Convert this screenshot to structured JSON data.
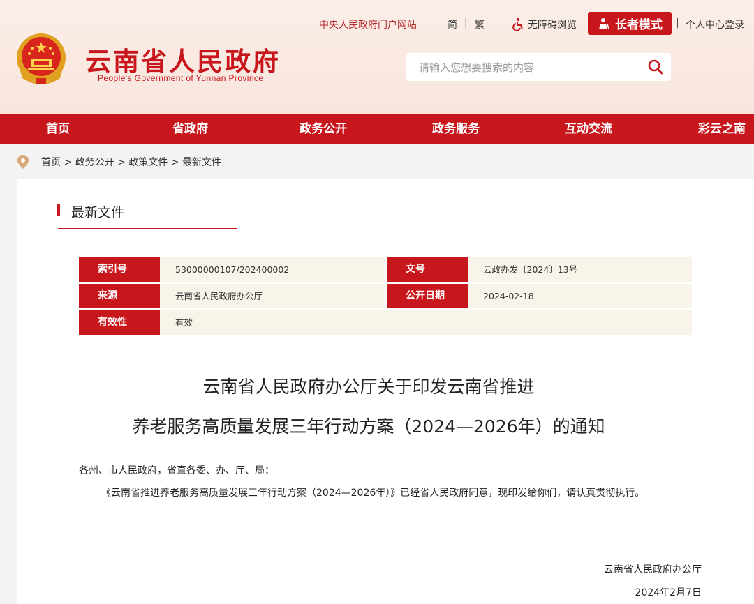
{
  "header": {
    "site_cn": "云南省人民政府",
    "site_en": "People's Government of Yunnan Province",
    "top_links": {
      "central_portal": "中央人民政府门户网站",
      "simplified": "简",
      "traditional": "繁",
      "accessibility": "无障碍浏览",
      "elder_mode": "长者模式",
      "user_center": "个人中心登录",
      "separator": "|"
    },
    "search": {
      "placeholder": "请输入您想要搜索的内容"
    }
  },
  "nav": {
    "items": [
      "首页",
      "省政府",
      "政务公开",
      "政务服务",
      "互动交流",
      "彩云之南"
    ]
  },
  "breadcrumb": {
    "path": "首页 > 政务公开 > 政策文件 > 最新文件"
  },
  "section": {
    "title": "最新文件"
  },
  "meta": {
    "index_label": "索引号",
    "index_value": "53000000107/202400002",
    "doc_no_label": "文号",
    "doc_no_value": "云政办发〔2024〕13号",
    "source_label": "来源",
    "source_value": "云南省人民政府办公厅",
    "pub_date_label": "公开日期",
    "pub_date_value": "2024-02-18",
    "validity_label": "有效性",
    "validity_value": "有效"
  },
  "document": {
    "title_line1": "云南省人民政府办公厅关于印发云南省推进",
    "title_line2": "养老服务高质量发展三年行动方案（2024—2026年）的通知",
    "recipients": "各州、市人民政府，省直各委、办、厅、局：",
    "body": "《云南省推进养老服务高质量发展三年行动方案（2024—2026年）》已经省人民政府同意，现印发给你们，请认真贯彻执行。",
    "signer": "云南省人民政府办公厅",
    "date": "2024年2月7日"
  },
  "colors": {
    "brand_red": "#c8161d",
    "meta_bg": "#f8f4ea",
    "header_bg": "#fbeee8"
  }
}
